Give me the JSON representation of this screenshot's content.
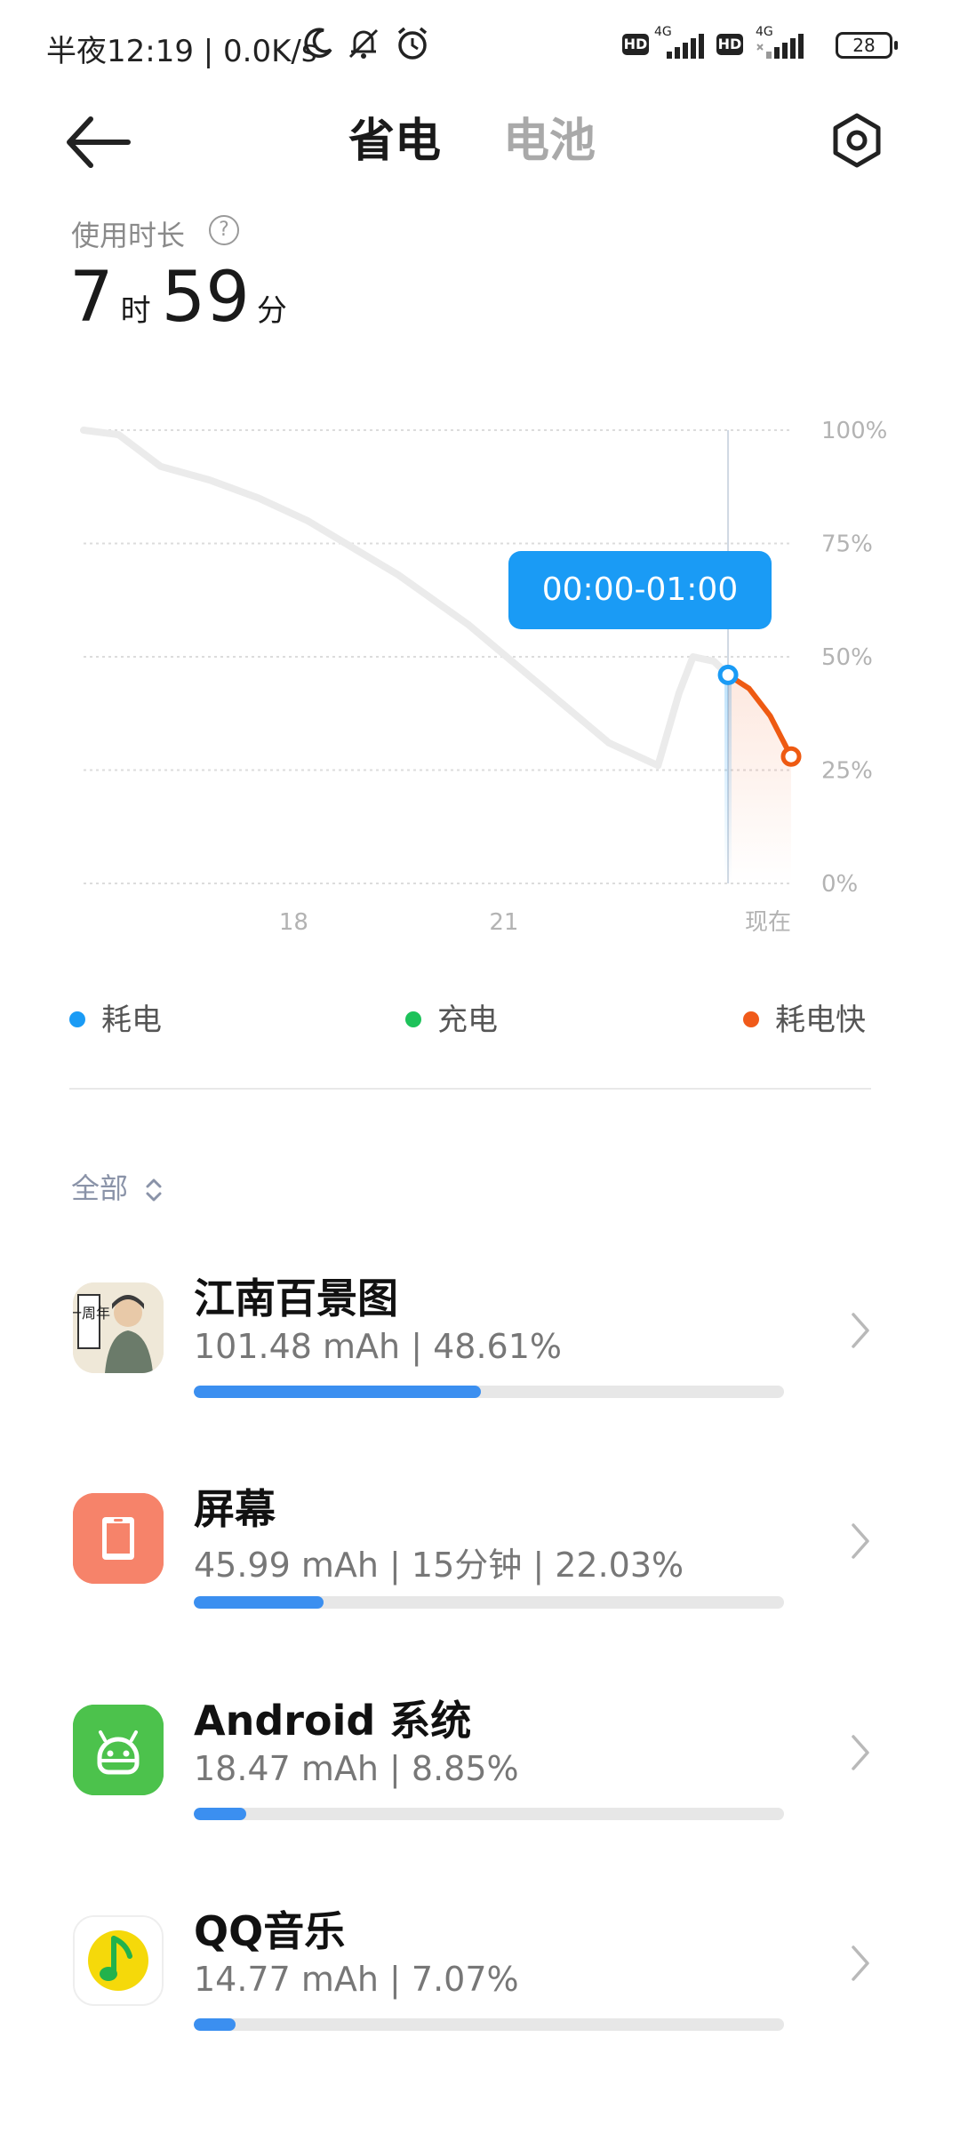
{
  "status_bar": {
    "text": "半夜12:19 | 0.0K/s",
    "hd_label": "HD",
    "net_label": "4G",
    "battery_level": "28"
  },
  "header": {
    "tab_active": "省电",
    "tab_inactive": "电池"
  },
  "usage": {
    "label": "使用时长",
    "help": "?",
    "hours": "7",
    "hours_unit": "时",
    "minutes": "59",
    "minutes_unit": "分"
  },
  "tooltip": "00:00-01:00",
  "chart_data": {
    "type": "line",
    "y_ticks": [
      "100%",
      "75%",
      "50%",
      "25%",
      "0%"
    ],
    "x_ticks": [
      "18",
      "21",
      "现在"
    ],
    "ylim": [
      0,
      100
    ],
    "series": [
      {
        "name": "耗电",
        "color": "#ebebeb",
        "points": [
          [
            15.0,
            100
          ],
          [
            15.5,
            99
          ],
          [
            16.1,
            92
          ],
          [
            16.8,
            89
          ],
          [
            17.5,
            85
          ],
          [
            18.2,
            80
          ],
          [
            19.5,
            68
          ],
          [
            20.5,
            57
          ],
          [
            21.5,
            44
          ],
          [
            22.5,
            31
          ],
          [
            23.2,
            26
          ],
          [
            23.5,
            42
          ],
          [
            23.7,
            50
          ],
          [
            24.0,
            49
          ],
          [
            24.2,
            46
          ]
        ]
      },
      {
        "name": "耗电快",
        "color": "#ee5a12",
        "points": [
          [
            24.2,
            46
          ],
          [
            24.5,
            43
          ],
          [
            24.8,
            37
          ],
          [
            25.1,
            28
          ]
        ]
      }
    ],
    "marker_points": [
      {
        "x": 24.2,
        "y": 46,
        "color": "#1a9bf5"
      },
      {
        "x": 25.1,
        "y": 28,
        "color": "#ee5a12"
      }
    ]
  },
  "legend": [
    {
      "label": "耗电",
      "color": "#1a9bf5"
    },
    {
      "label": "充电",
      "color": "#1dc25a"
    },
    {
      "label": "耗电快",
      "color": "#f05a1a"
    }
  ],
  "filter": {
    "label": "全部"
  },
  "apps": [
    {
      "name": "江南百景图",
      "detail": "101.48 mAh | 48.61%",
      "percent": 48.61,
      "icon": "jiangnan-app-icon",
      "badge": "一周年"
    },
    {
      "name": "屏幕",
      "detail": "45.99 mAh | 15分钟 | 22.03%",
      "percent": 22.03,
      "icon": "screen-icon",
      "color": "#f6836a"
    },
    {
      "name": "Android 系统",
      "detail": "18.47 mAh | 8.85%",
      "percent": 8.85,
      "icon": "android-icon",
      "color": "#4cc24c"
    },
    {
      "name": "QQ音乐",
      "detail": "14.77 mAh | 7.07%",
      "percent": 7.07,
      "icon": "qq-music-icon",
      "color": "#f5d90a"
    }
  ]
}
